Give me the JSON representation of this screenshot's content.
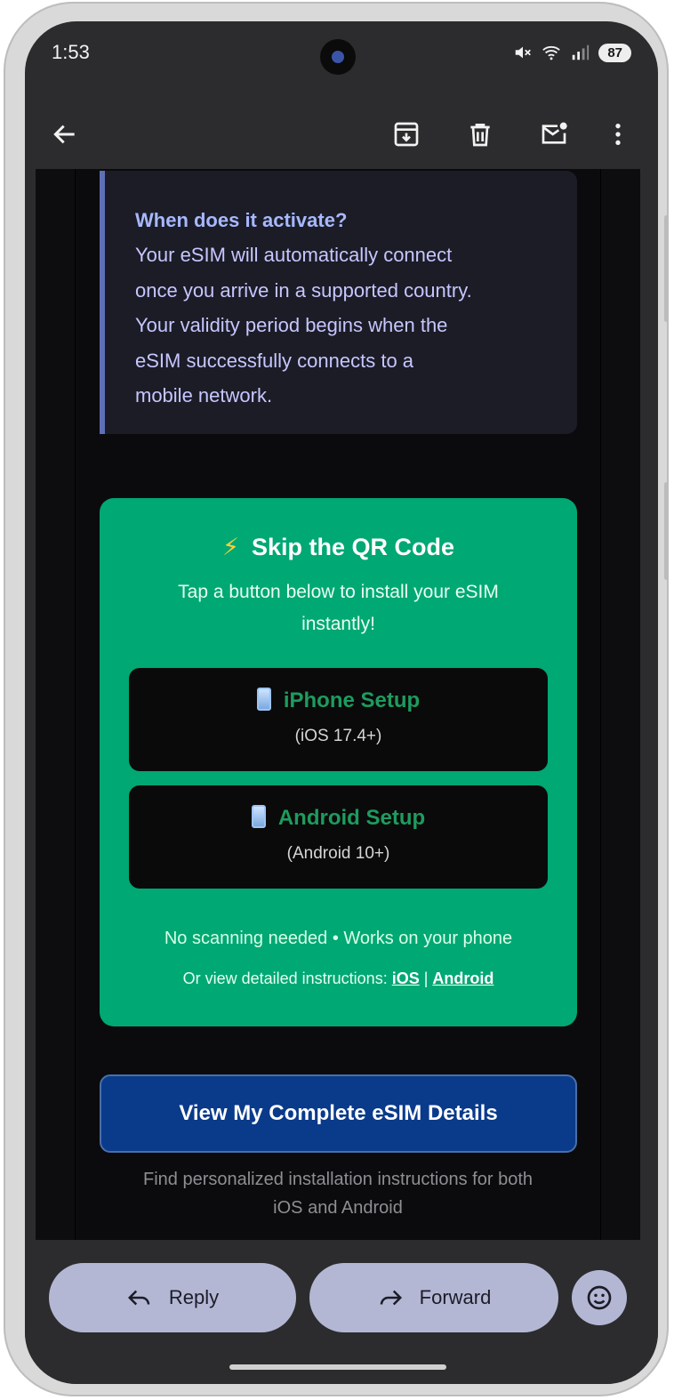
{
  "status_bar": {
    "time": "1:53",
    "battery": "87"
  },
  "toolbar": {
    "icons": [
      "back-arrow-icon",
      "archive-icon",
      "trash-icon",
      "mark-unread-icon",
      "more-vert-icon"
    ]
  },
  "email": {
    "info_box": {
      "title": "When does it activate?",
      "lines": [
        "Your eSIM will automatically connect",
        "once you arrive in a supported country.",
        "Your validity period begins when the",
        "eSIM successfully connects to a",
        "mobile network."
      ]
    },
    "skip_box": {
      "title_emoji": "⚡",
      "title": "Skip the QR Code",
      "subtitle_line1": "Tap a button below to install your eSIM",
      "subtitle_line2": "instantly!",
      "iphone_button": {
        "label": "iPhone Setup",
        "sub": "(iOS 17.4+)"
      },
      "android_button": {
        "label": "Android Setup",
        "sub": "(Android 10+)"
      },
      "footer1": "No scanning needed • Works on your phone",
      "footer2_prefix": "Or view detailed instructions: ",
      "footer2_link_ios": "iOS",
      "footer2_sep": " | ",
      "footer2_link_android": "Android",
      "accent_color": "#00a873"
    },
    "details_button": "View My Complete eSIM Details",
    "details_note_line1": "Find personalized installation instructions for both",
    "details_note_line2": "iOS and Android"
  },
  "bottom_bar": {
    "reply": "Reply",
    "forward": "Forward"
  }
}
